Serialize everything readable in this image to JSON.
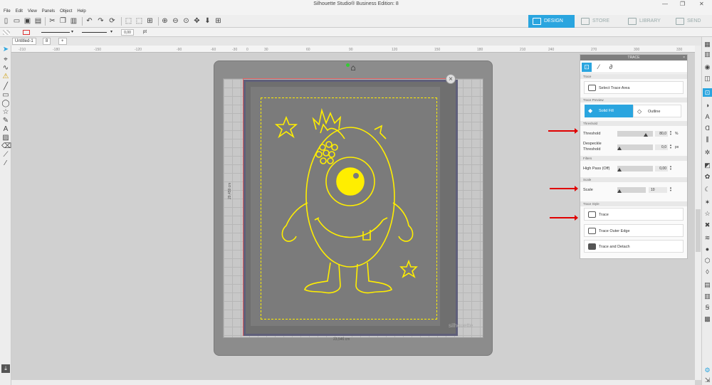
{
  "window": {
    "title": "Silhouette Studio® Business Edition: 8",
    "controls": [
      "—",
      "❐",
      "✕"
    ]
  },
  "menu": [
    "File",
    "Edit",
    "View",
    "Panels",
    "Object",
    "Help"
  ],
  "nav_tabs": [
    {
      "label": "DESIGN",
      "active": true
    },
    {
      "label": "STORE",
      "active": false
    },
    {
      "label": "LIBRARY",
      "active": false
    },
    {
      "label": "SEND",
      "active": false
    }
  ],
  "toolbar2": {
    "line_width_value": "0,00",
    "line_width_unit": "pt"
  },
  "doc_tabs": [
    "Untitled-1",
    "8",
    "+"
  ],
  "ruler_ticks": [
    "-210",
    "-180",
    "-150",
    "-120",
    "-90",
    "-60",
    "-30",
    "0",
    "30",
    "60",
    "90",
    "120",
    "150",
    "180",
    "210",
    "240",
    "270",
    "300",
    "330"
  ],
  "canvas": {
    "width_label": "23,546 cm",
    "height_label": "29,459 cm",
    "watermark": "silhouette"
  },
  "trace_panel": {
    "title": "TRACE",
    "close": "×",
    "sections": {
      "trace": "Trace",
      "trace_preview": "Trace Preview",
      "threshold": "Threshold",
      "filters": "Filters",
      "scale": "Scale",
      "trace_style": "Trace Style"
    },
    "select_trace_area": "Select Trace Area",
    "preview_options": [
      {
        "label": "Solid Fill",
        "active": true
      },
      {
        "label": "Outline",
        "active": false
      }
    ],
    "threshold": {
      "label": "Threshold",
      "value": "80,0",
      "unit": "%",
      "level": 0.8
    },
    "despeckle": {
      "label_line1": "Despeckle",
      "label_line2": "Threshold",
      "value": "0,0",
      "unit": "px",
      "level": 0.0
    },
    "high_pass": {
      "label": "High Pass (Off)",
      "value": "0,00",
      "level": 0.0
    },
    "scale": {
      "label": "Scale",
      "value": "10",
      "level": 0.0
    },
    "trace_buttons": [
      "Trace",
      "Trace Outer Edge",
      "Trace and Detach"
    ]
  },
  "colors": {
    "accent": "#2aa5df",
    "trace_yellow": "#ffee00",
    "arrow_red": "#e00000"
  }
}
